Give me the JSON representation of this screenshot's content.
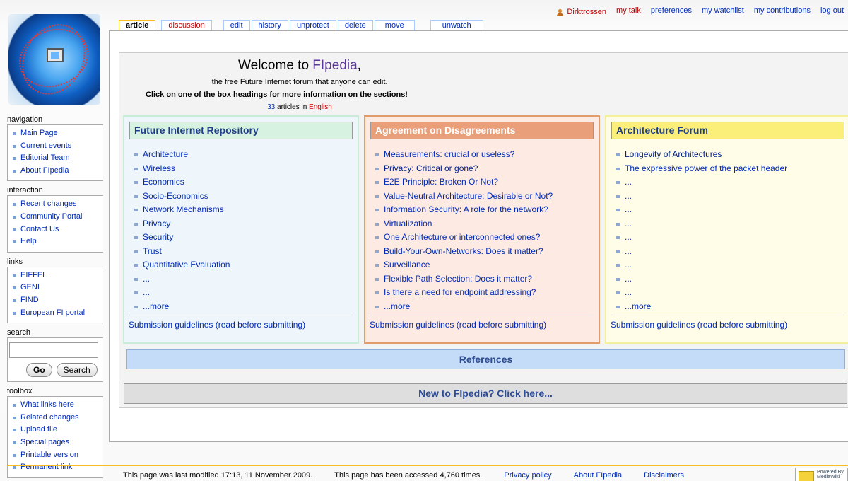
{
  "personal_tools": {
    "username": "Dirktrossen",
    "items": [
      "my talk",
      "preferences",
      "my watchlist",
      "my contributions",
      "log out"
    ]
  },
  "tabs": [
    "article",
    "discussion",
    "edit",
    "history",
    "unprotect",
    "delete",
    "move",
    "unwatch"
  ],
  "sidebar": {
    "navigation": {
      "title": "navigation",
      "items": [
        "Main Page",
        "Current events",
        "Editorial Team",
        "About FIpedia"
      ]
    },
    "interaction": {
      "title": "interaction",
      "items": [
        "Recent changes",
        "Community Portal",
        "Contact Us",
        "Help"
      ]
    },
    "links": {
      "title": "links",
      "items": [
        "EIFFEL",
        "GENI",
        "FIND",
        "European FI portal"
      ]
    },
    "search": {
      "title": "search",
      "go_label": "Go",
      "search_label": "Search",
      "value": ""
    },
    "toolbox": {
      "title": "toolbox",
      "items": [
        "What links here",
        "Related changes",
        "Upload file",
        "Special pages",
        "Printable version",
        "Permanent link"
      ]
    }
  },
  "welcome": {
    "title_prefix": "Welcome to ",
    "title_name": "FIpedia",
    "title_suffix": ",",
    "subtitle": "the free Future Internet forum that anyone can edit.",
    "instruction": "Click on one of the box headings for more information on the sections!",
    "article_count": "33",
    "articles_in": " articles in ",
    "language": "English"
  },
  "boxes": {
    "repository": {
      "heading": "Future Internet Repository",
      "items": [
        "Architecture",
        "Wireless",
        "Economics",
        "Socio-Economics",
        "Network Mechanisms",
        "Privacy",
        "Security",
        "Trust",
        "Quantitative Evaluation",
        "...",
        "...",
        "...more"
      ],
      "guidelines": "Submission guidelines (read before submitting)"
    },
    "agreement": {
      "heading": "Agreement on Disagreements",
      "items": [
        "Measurements: crucial or useless?",
        "Privacy: Critical or gone?",
        "E2E Principle: Broken Or Not?",
        "Value-Neutral Architecture: Desirable or Not?",
        "Information Security: A role for the network?",
        "Virtualization",
        "One Architecture or interconnected ones?",
        "Build-Your-Own-Networks: Does it matter?",
        "Surveillance",
        "Flexible Path Selection: Does it matter?",
        "Is there a need for endpoint addressing?",
        "...more"
      ],
      "guidelines": "Submission guidelines (read before submitting)"
    },
    "forum": {
      "heading": "Architecture Forum",
      "items": [
        "Longevity of Architectures",
        "The expressive power of the packet header",
        "...",
        "...",
        "...",
        "...",
        "...",
        "...",
        "...",
        "...",
        "...",
        "...more"
      ],
      "guidelines": "Submission guidelines (read before submitting)"
    }
  },
  "references": "References",
  "new_to": "New to FIpedia? Click here...",
  "footer": {
    "last_modified": "This page was last modified 17:13, 11 November 2009.",
    "accessed": "This page has been accessed 4,760 times.",
    "links": [
      "Privacy policy",
      "About FIpedia",
      "Disclaimers"
    ],
    "badge": "Powered By MediaWiki"
  }
}
